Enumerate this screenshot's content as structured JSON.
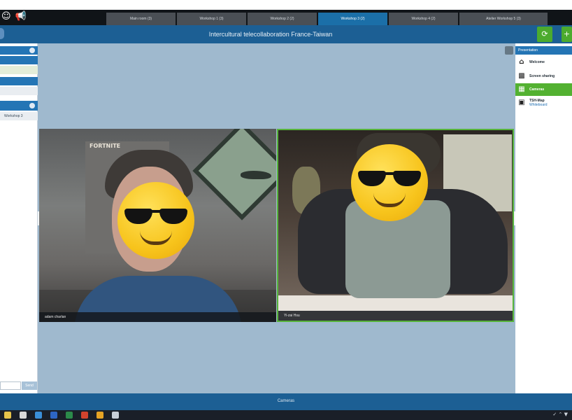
{
  "top_icons": [
    "user-icon",
    "megaphone-icon"
  ],
  "tabs": [
    {
      "label": "Main room (3)",
      "active": false
    },
    {
      "label": "Workshop 1 (3)",
      "active": false
    },
    {
      "label": "Workshop 2 (2)",
      "active": false
    },
    {
      "label": "Workshop 3 (2)",
      "active": true
    },
    {
      "label": "Workshop 4 (2)",
      "active": false
    },
    {
      "label": "Atelier Workshop 5 (3)",
      "active": false
    }
  ],
  "title": "Intercultural telecollaboration France-Taiwan",
  "left_panel": {
    "room_label": "Workshop 3",
    "send_label": "Send"
  },
  "videos": [
    {
      "caption": "adam charlan",
      "poster_text": "FORTNITE"
    },
    {
      "caption": "Yi-zai Hsu"
    }
  ],
  "right_panel": {
    "header": "Presentation",
    "items": [
      {
        "label": "Welcome",
        "icon": "home-icon"
      },
      {
        "label": "Screen sharing",
        "icon": "monitor-icon"
      },
      {
        "label": "Cameras",
        "icon": "camera-grid-icon",
        "active": true
      },
      {
        "label": "TSH-Map",
        "sub": "Whiteboard",
        "icon": "camera-icon"
      }
    ]
  },
  "bottom_label": "Cameras",
  "colors": {
    "title_bar": "#1c5f94",
    "stage": "#9fb9ce",
    "active_green": "#53b131",
    "active_tab": "#1b6fa8"
  }
}
